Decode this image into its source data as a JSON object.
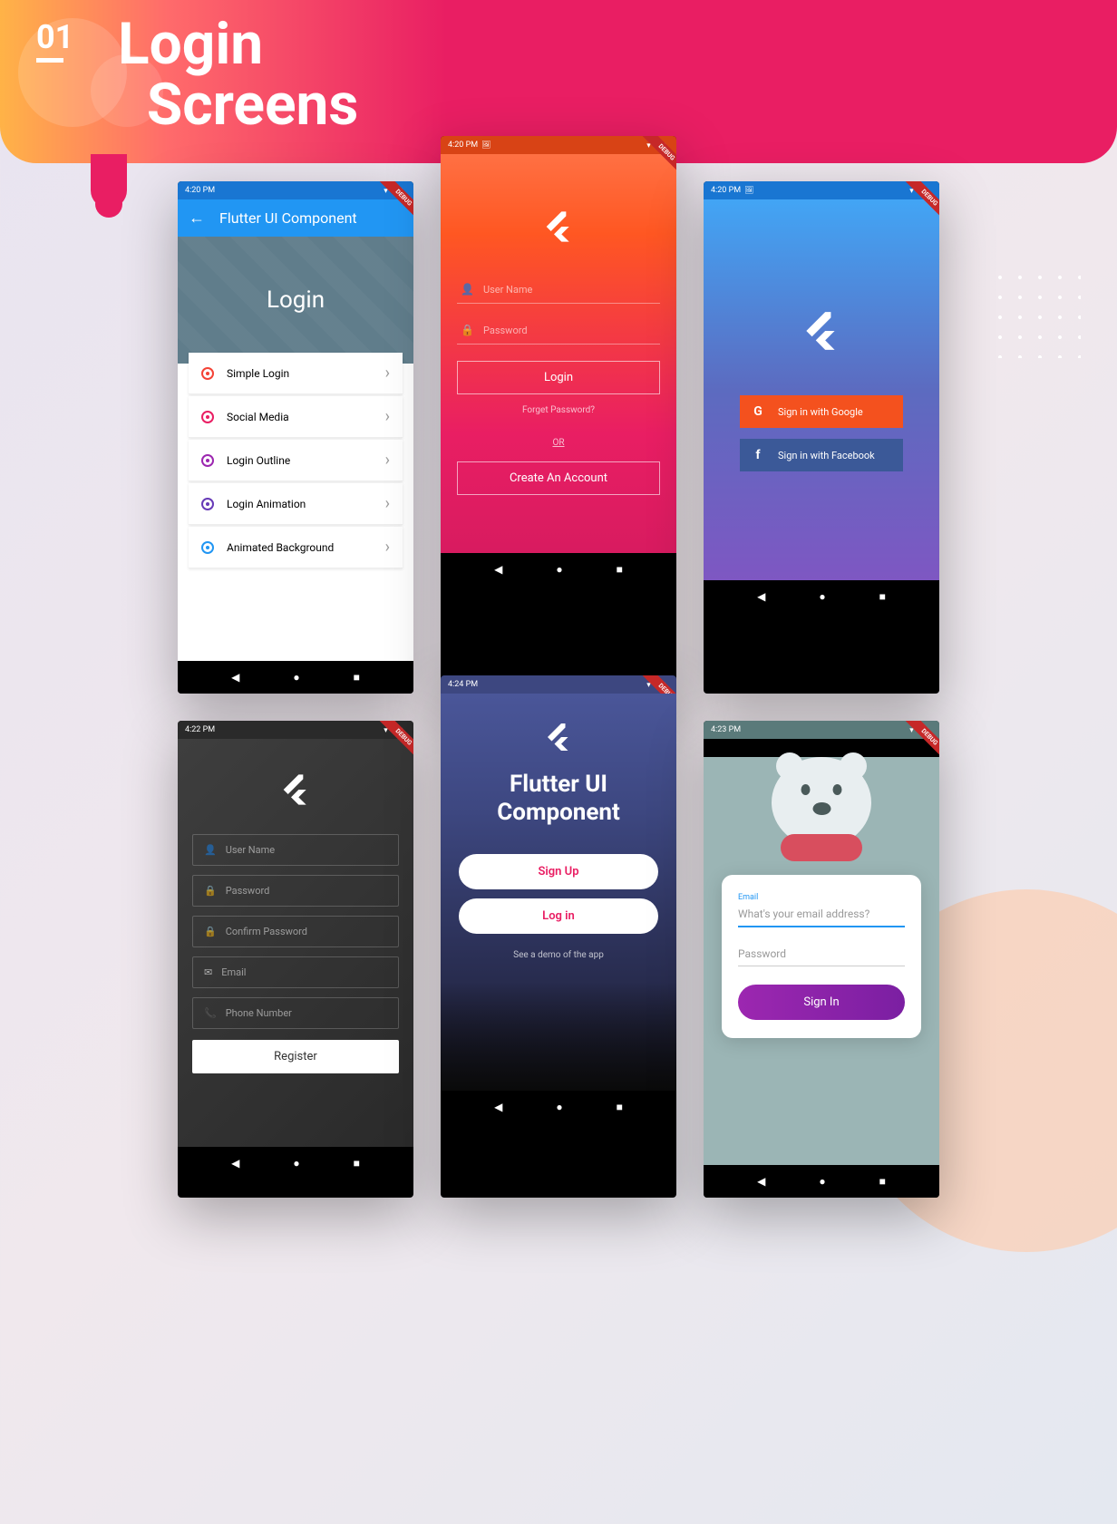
{
  "header": {
    "number": "01",
    "title_line1": "Login",
    "title_line2": "Screens"
  },
  "status": {
    "time1": "4:20 PM",
    "time2": "4:20 PM",
    "time3": "4:20 PM",
    "time4": "4:22 PM",
    "time5": "4:24 PM",
    "time6": "4:23 PM",
    "debug": "DEBUG"
  },
  "phone1": {
    "appbar_title": "Flutter UI Component",
    "hero_title": "Login",
    "items": [
      {
        "label": "Simple Login",
        "color": "#f44336"
      },
      {
        "label": "Social Media",
        "color": "#e91e63"
      },
      {
        "label": "Login Outline",
        "color": "#9c27b0"
      },
      {
        "label": "Login Animation",
        "color": "#673ab7"
      },
      {
        "label": "Animated Background",
        "color": "#2196f3"
      }
    ]
  },
  "phone2": {
    "username_label": "User Name",
    "password_label": "Password",
    "login_btn": "Login",
    "forgot": "Forget Password?",
    "or": "OR",
    "create": "Create An Account"
  },
  "phone3": {
    "google_btn": "Sign in with Google",
    "google_icon": "G",
    "fb_btn": "Sign in with Facebook",
    "fb_icon": "f"
  },
  "phone4": {
    "username": "User Name",
    "password": "Password",
    "confirm": "Confirm Password",
    "email": "Email",
    "phone": "Phone Number",
    "register": "Register"
  },
  "phone5": {
    "title_line1": "Flutter UI",
    "title_line2": "Component",
    "signup": "Sign Up",
    "login": "Log in",
    "demo": "See a demo of the app"
  },
  "phone6": {
    "email_label": "Email",
    "email_placeholder": "What's your email address?",
    "password_label": "Password",
    "signin": "Sign In"
  }
}
